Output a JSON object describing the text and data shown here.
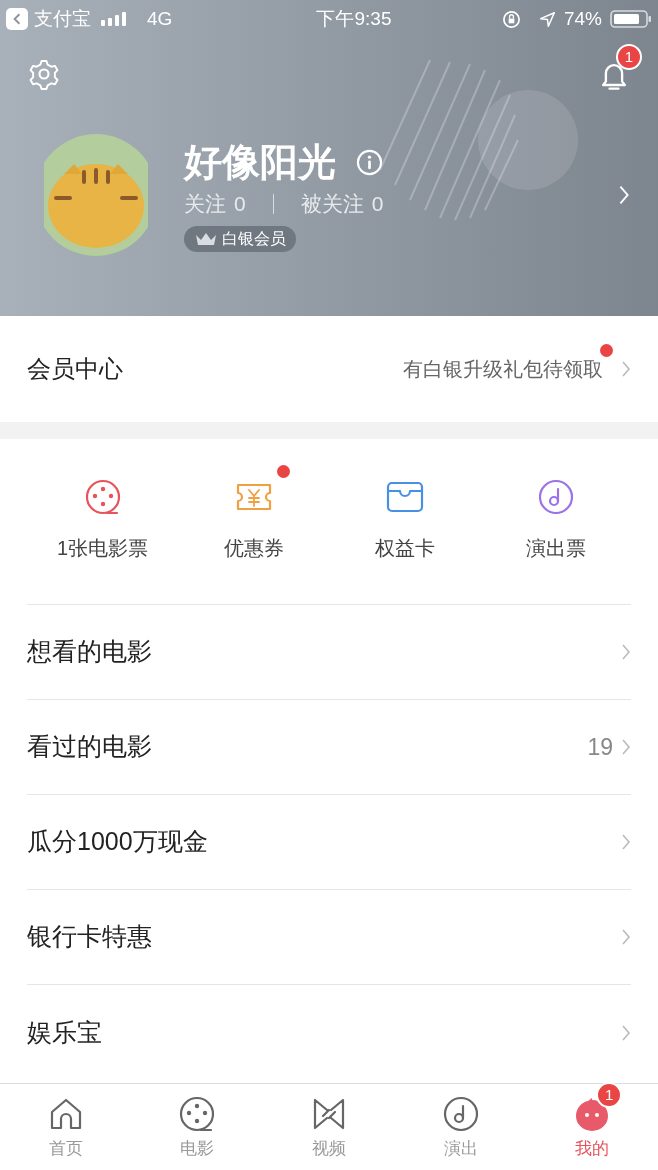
{
  "status_bar": {
    "back_app": "支付宝",
    "network": "4G",
    "time": "下午9:35",
    "battery": "74%"
  },
  "header": {
    "notification_badge": "1",
    "name": "好像阳光",
    "following_label": "关注",
    "following": "0",
    "followers_label": "被关注",
    "followers": "0",
    "member_level": "白银会员"
  },
  "member_center": {
    "title": "会员中心",
    "hint": "有白银升级礼包待领取",
    "dot": true
  },
  "shortcuts": [
    {
      "kind": "film",
      "label": "1张电影票",
      "dot": false,
      "color": "#e8535b"
    },
    {
      "kind": "coupon",
      "label": "优惠券",
      "dot": true,
      "color": "#f0a040"
    },
    {
      "kind": "card",
      "label": "权益卡",
      "dot": false,
      "color": "#4a90e2"
    },
    {
      "kind": "music",
      "label": "演出票",
      "dot": false,
      "color": "#9b72e8"
    }
  ],
  "menu": [
    {
      "label": "想看的电影"
    },
    {
      "label": "看过的电影",
      "count": "19"
    },
    {
      "label": "瓜分1000万现金"
    },
    {
      "label": "银行卡特惠"
    },
    {
      "label": "娱乐宝"
    }
  ],
  "tab_bar": [
    {
      "kind": "home",
      "label": "首页",
      "selected": false
    },
    {
      "kind": "film",
      "label": "电影",
      "selected": false
    },
    {
      "kind": "video",
      "label": "视频",
      "selected": false
    },
    {
      "kind": "music",
      "label": "演出",
      "selected": false
    },
    {
      "kind": "me",
      "label": "我的",
      "selected": true,
      "badge": "1"
    }
  ]
}
